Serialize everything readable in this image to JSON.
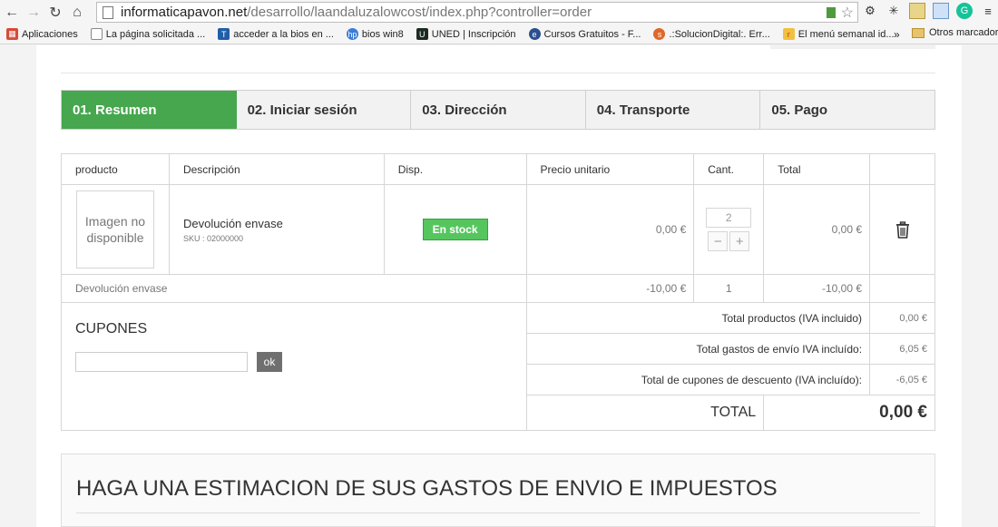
{
  "browser": {
    "url_host": "informaticapavon.net",
    "url_path": "/desarrollo/laandaluzalowcost/index.php?controller=order"
  },
  "bookmarks": [
    {
      "label": "Aplicaciones",
      "color": "#d84a38"
    },
    {
      "label": "La página solicitada ...",
      "color": "#ffffff"
    },
    {
      "label": "acceder a la bios en ...",
      "color": "#1f5ea8"
    },
    {
      "label": "bios win8",
      "color": "#3b7dd8"
    },
    {
      "label": "UNED | Inscripción",
      "color": "#1b2b22"
    },
    {
      "label": "Cursos Gratuitos - F...",
      "color": "#2a4f8f"
    },
    {
      "label": ".:SolucionDigital:. Err...",
      "color": "#e0662a"
    },
    {
      "label": "El menú semanal id...",
      "color": "#f0c040"
    }
  ],
  "bookmarks_more": "»",
  "bookmarks_other": "Otros marcadores",
  "steps": [
    {
      "label": "01. Resumen",
      "active": true
    },
    {
      "label": "02. Iniciar sesión",
      "active": false
    },
    {
      "label": "03. Dirección",
      "active": false
    },
    {
      "label": "04. Transporte",
      "active": false
    },
    {
      "label": "05. Pago",
      "active": false
    }
  ],
  "cart": {
    "headers": [
      "producto",
      "Descripción",
      "Disp.",
      "Precio unitario",
      "Cant.",
      "Total"
    ],
    "item": {
      "image_text_1": "Imagen no",
      "image_text_2": "disponible",
      "name": "Devolución envase",
      "sku": "SKU : 02000000",
      "availability": "En stock",
      "unit_price": "0,00 €",
      "qty": "2",
      "total": "0,00 €"
    },
    "gift": {
      "name": "Devolución envase",
      "unit_price": "-10,00 €",
      "qty": "1",
      "total": "-10,00 €"
    }
  },
  "coupons": {
    "title": "CUPONES",
    "button": "ok"
  },
  "summary": [
    {
      "label": "Total productos (IVA incluido)",
      "value": "0,00 €"
    },
    {
      "label": "Total gastos de envío IVA incluído:",
      "value": "6,05 €"
    },
    {
      "label": "Total de cupones de descuento (IVA incluído):",
      "value": "-6,05 €"
    }
  ],
  "total": {
    "label": "TOTAL",
    "value": "0,00 €"
  },
  "estimate": {
    "title": "HAGA UNA ESTIMACION DE SUS GASTOS DE ENVIO E IMPUESTOS"
  }
}
